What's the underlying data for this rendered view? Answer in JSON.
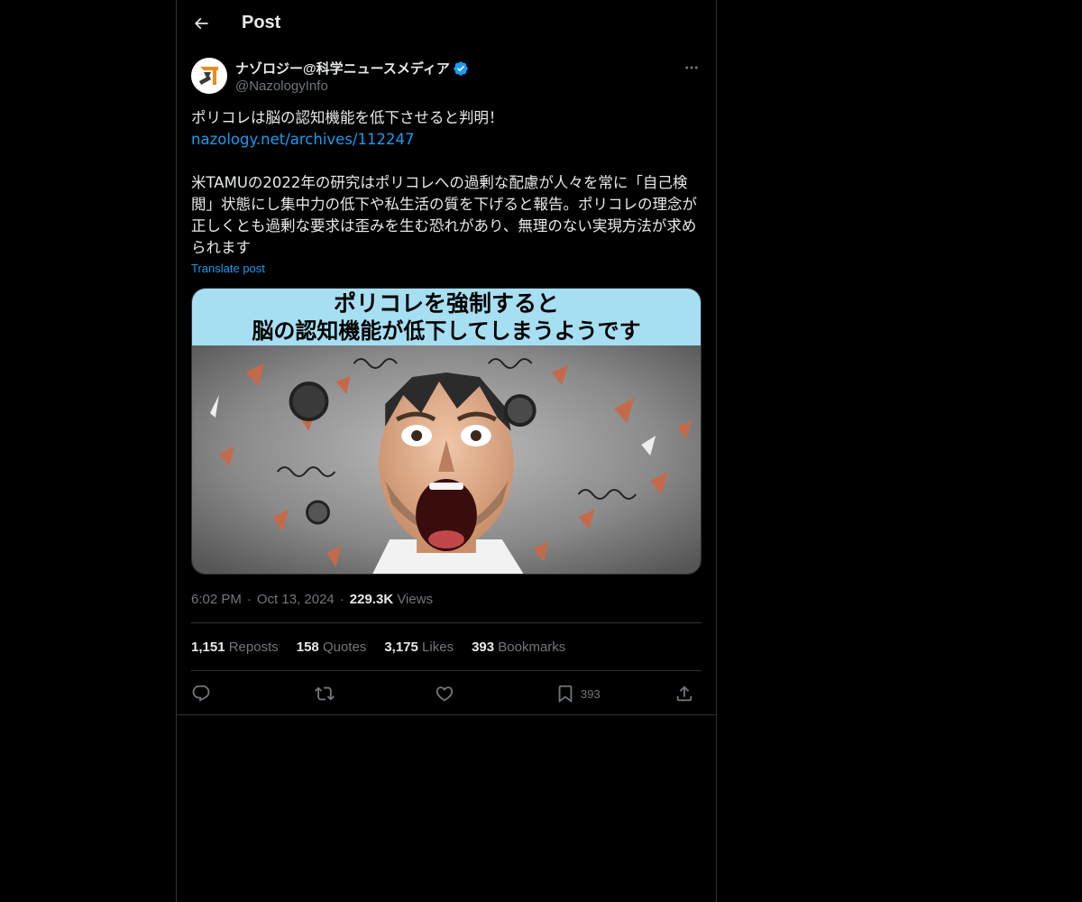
{
  "header": {
    "title": "Post",
    "back_icon": "back-arrow-icon"
  },
  "author": {
    "display_name": "ナゾロジー@科学ニュースメディア",
    "handle": "@NazologyInfo",
    "verified": true,
    "verified_color": "#1d9bf0"
  },
  "post": {
    "line1": "ポリコレは脳の認知機能を低下させると判明！",
    "link": "nazology.net/archives/112247",
    "body": "米TAMUの2022年の研究はポリコレへの過剰な配慮が人々を常に「自己検閲」状態にし集中力の低下や私生活の質を下げると報告。ポリコレの理念が正しくとも過剰な要求は歪みを生む恐れがあり、無理のない実現方法が求められます",
    "translate_label": "Translate post"
  },
  "media": {
    "banner_line1": "ポリコレを強制すると",
    "banner_line2": "脳の認知機能が低下してしまうようです",
    "banner_color": "#a6dff2"
  },
  "meta": {
    "time": "6:02 PM",
    "separator": "·",
    "date": "Oct 13, 2024",
    "views_count": "229.3K",
    "views_label": "Views"
  },
  "stats": {
    "reposts_count": "1,151",
    "reposts_label": "Reposts",
    "quotes_count": "158",
    "quotes_label": "Quotes",
    "likes_count": "3,175",
    "likes_label": "Likes",
    "bookmarks_count": "393",
    "bookmarks_label": "Bookmarks"
  },
  "actions": {
    "reply_icon": "reply-icon",
    "repost_icon": "repost-icon",
    "like_icon": "heart-icon",
    "bookmark_icon": "bookmark-icon",
    "bookmark_count": "393",
    "share_icon": "share-icon"
  },
  "colors": {
    "background": "#000000",
    "text": "#e7e9ea",
    "muted": "#71767b",
    "accent": "#1d9bf0",
    "border": "#2f3336"
  }
}
